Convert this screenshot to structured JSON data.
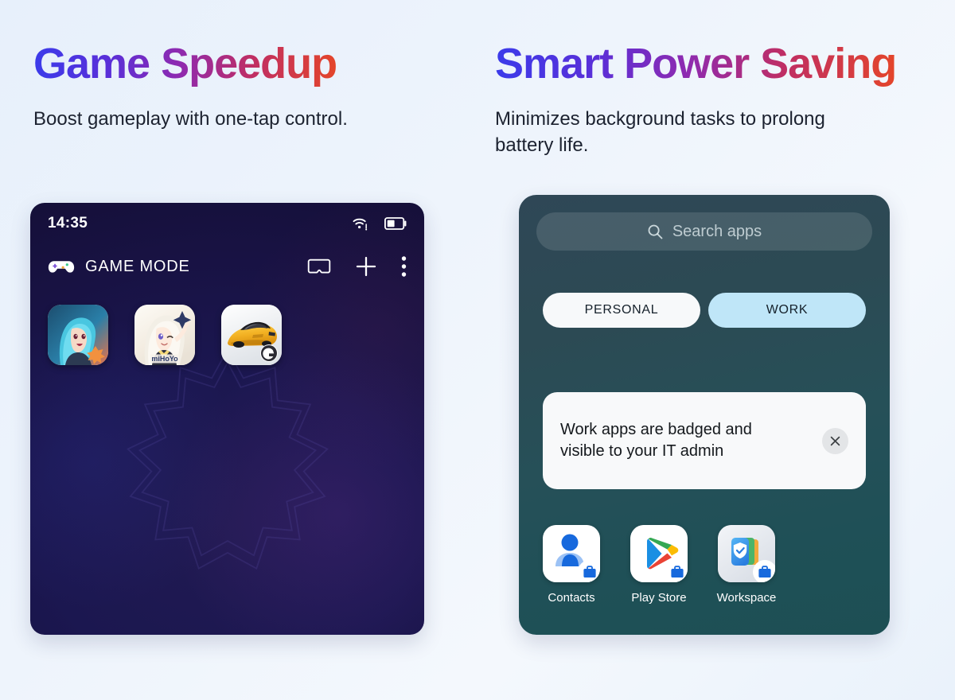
{
  "theme": {
    "page_bg": "#eaf2fb",
    "title_gradient_start": "#3b3bea",
    "title_gradient_mid": "#8e2ab0",
    "title_gradient_end": "#e4452a",
    "game_card_bg": "#1b1750",
    "work_card_bg_top": "#2f4756",
    "work_card_bg_bottom": "#1d4f54",
    "work_tab_active": "#bfe6f8",
    "work_tab_inactive": "#f7f9fa"
  },
  "features": {
    "left": {
      "title": "Game Speedup",
      "subtitle": "Boost gameplay with one-tap control."
    },
    "right": {
      "title": "Smart Power Saving",
      "subtitle": "Minimizes background tasks to prolong battery life."
    }
  },
  "game_panel": {
    "status_bar": {
      "clock": "14:35",
      "wifi_icon": "wifi-icon",
      "battery_icon": "battery-icon",
      "battery_level_percent": 45
    },
    "header": {
      "icon": "gamepad-icon",
      "title": "GAME MODE",
      "actions": [
        {
          "name": "vr-headset-icon",
          "label": "VR headset"
        },
        {
          "name": "plus-icon",
          "label": "Add"
        },
        {
          "name": "more-vertical-icon",
          "label": "More options"
        }
      ]
    },
    "games": [
      {
        "name": "mobile-legends-icon",
        "label": "Mobile Legends"
      },
      {
        "name": "mihoyo-icon",
        "label": "miHoYo"
      },
      {
        "name": "asphalt-racing-icon",
        "label": "Asphalt"
      }
    ],
    "mihoyo_wordmark": "miHoYo"
  },
  "work_panel": {
    "search": {
      "placeholder": "Search apps",
      "icon": "search-icon"
    },
    "tabs": [
      {
        "label": "PERSONAL",
        "selected": false
      },
      {
        "label": "WORK",
        "selected": true
      }
    ],
    "notice": {
      "text": "Work apps are badged and visible to your IT admin",
      "close_icon": "close-icon",
      "close_glyph": "×"
    },
    "apps": [
      {
        "label": "Contacts",
        "icon": "contacts-icon",
        "badge": "work-briefcase-badge"
      },
      {
        "label": "Play Store",
        "icon": "play-store-icon",
        "badge": "work-briefcase-badge"
      },
      {
        "label": "Workspace",
        "icon": "workspace-shield-icon",
        "badge": "work-briefcase-badge"
      }
    ]
  }
}
